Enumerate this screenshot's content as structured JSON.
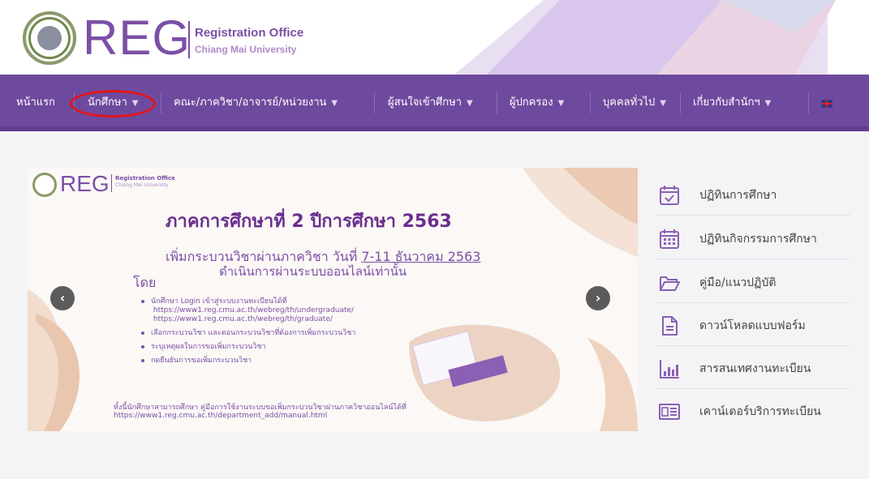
{
  "header": {
    "logo_text": "REG",
    "office_line1": "Registration Office",
    "office_line2": "Chiang Mai University"
  },
  "nav": {
    "items": [
      {
        "label": "หน้าแรก",
        "has_caret": false
      },
      {
        "label": "นักศึกษา",
        "has_caret": true
      },
      {
        "label": "คณะ/ภาควิชา/อาจารย์/หน่วยงาน",
        "has_caret": true
      },
      {
        "label": "ผู้สนใจเข้าศึกษา",
        "has_caret": true
      },
      {
        "label": "ผู้ปกครอง",
        "has_caret": true
      },
      {
        "label": "บุคคลทั่วไป",
        "has_caret": true
      },
      {
        "label": "เกี่ยวกับสำนักฯ",
        "has_caret": true
      }
    ],
    "caret": "▼",
    "language_icon": "uk-flag-icon",
    "highlight_color": "#e3151a"
  },
  "slide": {
    "logo_text": "REG",
    "office_line1": "Registration Office",
    "office_line2": "Chiang Mai University",
    "title": "ภาคการศึกษาที่ 2 ปีการศึกษา 2563",
    "sub_prefix": "เพิ่มกระบวนวิชาผ่านภาควิชา วันที่ ",
    "sub_dates": "7-11 ธันวาคม 2563",
    "sub_line2": "ดำเนินการผ่านระบบออนไลน์เท่านั้น",
    "by": "โดย",
    "bullets": [
      "นักศึกษา Login เข้าสู่ระบบงานทะเบียนได้ที่\n https://www1.reg.cmu.ac.th/webreg/th/undergraduate/\n https://www1.reg.cmu.ac.th/webreg/th/graduate/",
      "เลือกกระบวนวิชา และตอนกระบวนวิชาที่ต้องการเพิ่มกระบวนวิชา",
      "ระบุเหตุผลในการขอเพิ่มกระบวนวิชา",
      "กดยืนยันการขอเพิ่มกระบวนวิชา"
    ],
    "footer_line1": "ทั้งนี้นักศึกษาสามารถศึกษา คู่มือการใช้งานระบบขอเพิ่มกระบวนวิชาผ่านภาควิชาออนไลน์ได้ที่",
    "footer_line2": "https://www1.reg.cmu.ac.th/department_add/manual.html",
    "prev_glyph": "‹",
    "next_glyph": "›"
  },
  "side_menu": [
    {
      "label": "ปฏิทินการศึกษา",
      "icon": "calendar-check-icon"
    },
    {
      "label": "ปฏิทินกิจกรรมการศึกษา",
      "icon": "calendar-grid-icon"
    },
    {
      "label": "คู่มือ/แนวปฏิบัติ",
      "icon": "folder-open-icon"
    },
    {
      "label": "ดาวน์โหลดแบบฟอร์ม",
      "icon": "document-icon"
    },
    {
      "label": "สารสนเทศงานทะเบียน",
      "icon": "bar-chart-icon"
    },
    {
      "label": "เคาน์เตอร์บริการทะเบียน",
      "icon": "id-card-icon"
    }
  ],
  "colors": {
    "brand_purple": "#6e4a9e",
    "logo_purple": "#7b4fa6",
    "icon_purple": "#8a5fb4"
  }
}
